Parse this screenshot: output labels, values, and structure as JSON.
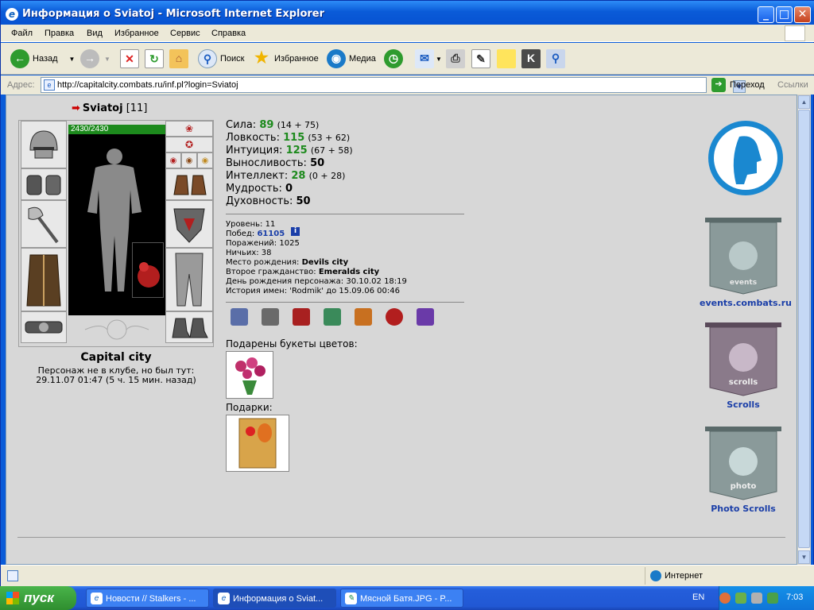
{
  "window": {
    "title": "Информация о Sviatoj - Microsoft Internet Explorer",
    "min": "_",
    "max": "□",
    "close": "✕"
  },
  "menu": [
    "Файл",
    "Правка",
    "Вид",
    "Избранное",
    "Сервис",
    "Справка"
  ],
  "toolbar": {
    "back": "Назад",
    "search": "Поиск",
    "favorites": "Избранное",
    "media": "Медиа"
  },
  "address": {
    "label": "Адрес:",
    "url": "http://capitalcity.combats.ru/inf.pl?login=Sviatoj",
    "go": "Переход",
    "links": "Ссылки"
  },
  "character": {
    "name": "Sviatoj",
    "level": "[11]",
    "hp": "2430/2430",
    "city": "Capital city",
    "club_note_1": "Персонаж не в клубе, но был тут:",
    "club_note_2": "29.11.07 01:47 (5 ч. 15 мин. назад)"
  },
  "stats": [
    {
      "label": "Сила:",
      "value": "89",
      "detail": "(14 + 75)",
      "green": true
    },
    {
      "label": "Ловкость:",
      "value": "115",
      "detail": "(53 + 62)",
      "green": true
    },
    {
      "label": "Интуиция:",
      "value": "125",
      "detail": "(67 + 58)",
      "green": true
    },
    {
      "label": "Выносливость:",
      "value": "50",
      "detail": "",
      "green": false
    },
    {
      "label": "Интеллект:",
      "value": "28",
      "detail": "(0 + 28)",
      "green": true
    },
    {
      "label": "Мудрость:",
      "value": "0",
      "detail": "",
      "green": false
    },
    {
      "label": "Духовность:",
      "value": "50",
      "detail": "",
      "green": false
    }
  ],
  "info": {
    "level": "Уровень: 11",
    "wins_label": "Побед:",
    "wins": "61105",
    "losses": "Поражений: 1025",
    "draws": "Ничьих: 38",
    "birthplace_label": "Место рождения:",
    "birthplace": "Devils city",
    "second_label": "Второе гражданство:",
    "second": "Emeralds city",
    "birthday": "День рождения персонажа: 30.10.02 18:19",
    "names_history": "История имен: 'Rodmik' до 15.09.06 00:46"
  },
  "flowers_title": "Подарены букеты цветов:",
  "gifts_title": "Подарки:",
  "sidebar": {
    "events": "events.combats.ru",
    "scrolls": "Scrolls",
    "photo": "Photo Scrolls",
    "events_banner": "events",
    "scrolls_banner": "scrolls",
    "photo_banner": "photo"
  },
  "status": {
    "zone": "Интернет"
  },
  "taskbar": {
    "start": "пуск",
    "tasks": [
      "Новости // Stalkers - ...",
      "Информация о Sviat...",
      "Мясной Батя.JPG - P..."
    ],
    "lang": "EN",
    "time": "7:03"
  }
}
